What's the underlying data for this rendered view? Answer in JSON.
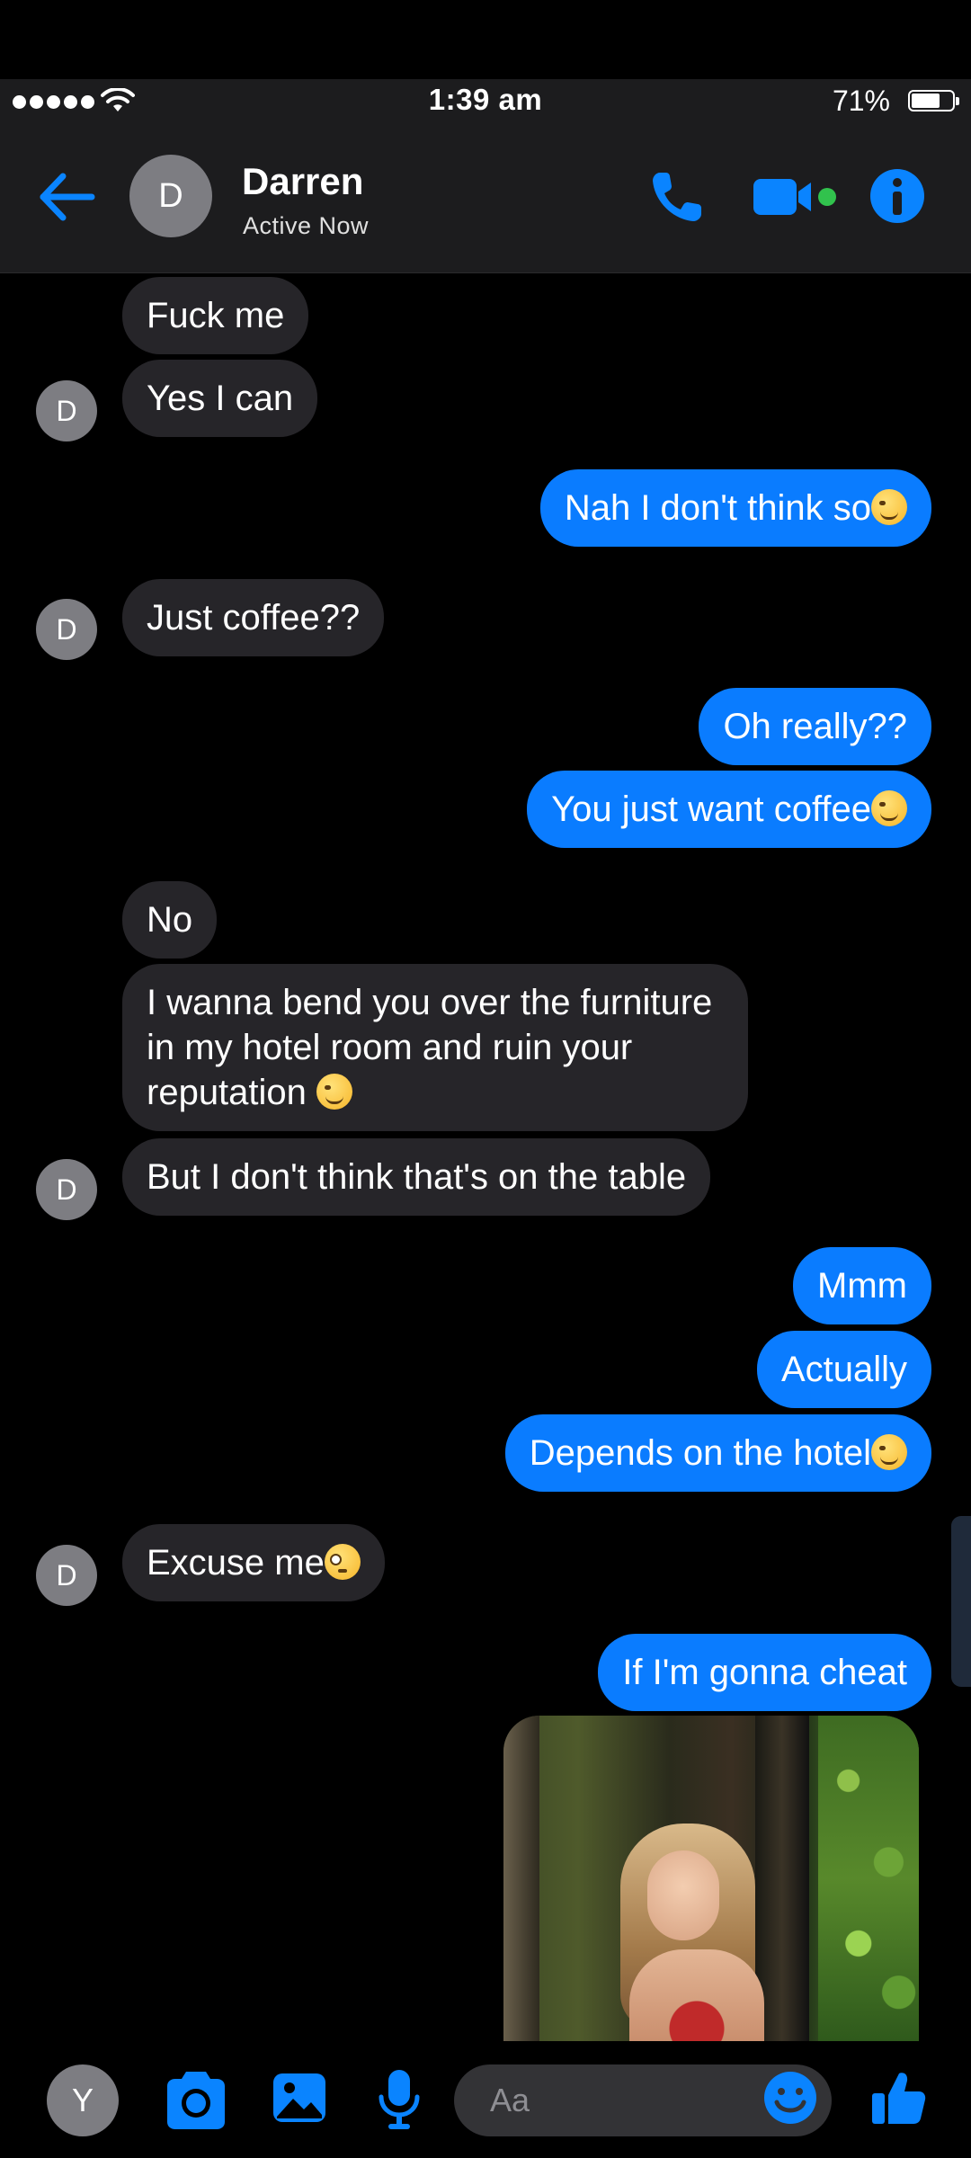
{
  "status_bar": {
    "time": "1:39 am",
    "battery_percent": "71%",
    "battery_level": 0.71
  },
  "header": {
    "avatar_initial": "D",
    "contact_name": "Darren",
    "contact_status": "Active Now"
  },
  "messages": [
    {
      "side": "in",
      "text": "Fuck me"
    },
    {
      "side": "in",
      "text": "Yes I can",
      "avatar": "D"
    },
    {
      "side": "out",
      "text": "Nah I don't think so",
      "emoji": "winking-face"
    },
    {
      "side": "in",
      "text": "Just coffee??",
      "avatar": "D"
    },
    {
      "side": "out",
      "text": "Oh really??"
    },
    {
      "side": "out",
      "text": "You just want coffee",
      "emoji": "winking-face"
    },
    {
      "side": "in",
      "text": "No"
    },
    {
      "side": "in",
      "text": "I wanna bend you over the furniture in my hotel room and ruin your reputation",
      "emoji": "relieved-face"
    },
    {
      "side": "in",
      "text": "But I don't think that's on the table",
      "avatar": "D"
    },
    {
      "side": "out",
      "text": "Mmm"
    },
    {
      "side": "out",
      "text": "Actually"
    },
    {
      "side": "out",
      "text": "Depends on the hotel",
      "emoji": "smirking-face"
    },
    {
      "side": "in",
      "text": "Excuse me",
      "emoji": "flushed-face",
      "avatar": "D"
    },
    {
      "side": "out",
      "text": "If I'm gonna cheat"
    },
    {
      "side": "out",
      "type": "photo"
    }
  ],
  "composer": {
    "avatar_initial": "Y",
    "placeholder": "Aa"
  },
  "icons": {
    "back": "arrow-left-icon",
    "call": "phone-icon",
    "video": "video-camera-icon",
    "info": "info-icon",
    "camera": "camera-icon",
    "gallery": "image-icon",
    "mic": "microphone-icon",
    "emoji": "smiley-icon",
    "like": "thumbs-up-icon"
  },
  "colors": {
    "accent": "#0a7cff",
    "incoming_bubble": "#262529",
    "header_bg": "#1c1c1e",
    "online_dot": "#31c24d"
  }
}
